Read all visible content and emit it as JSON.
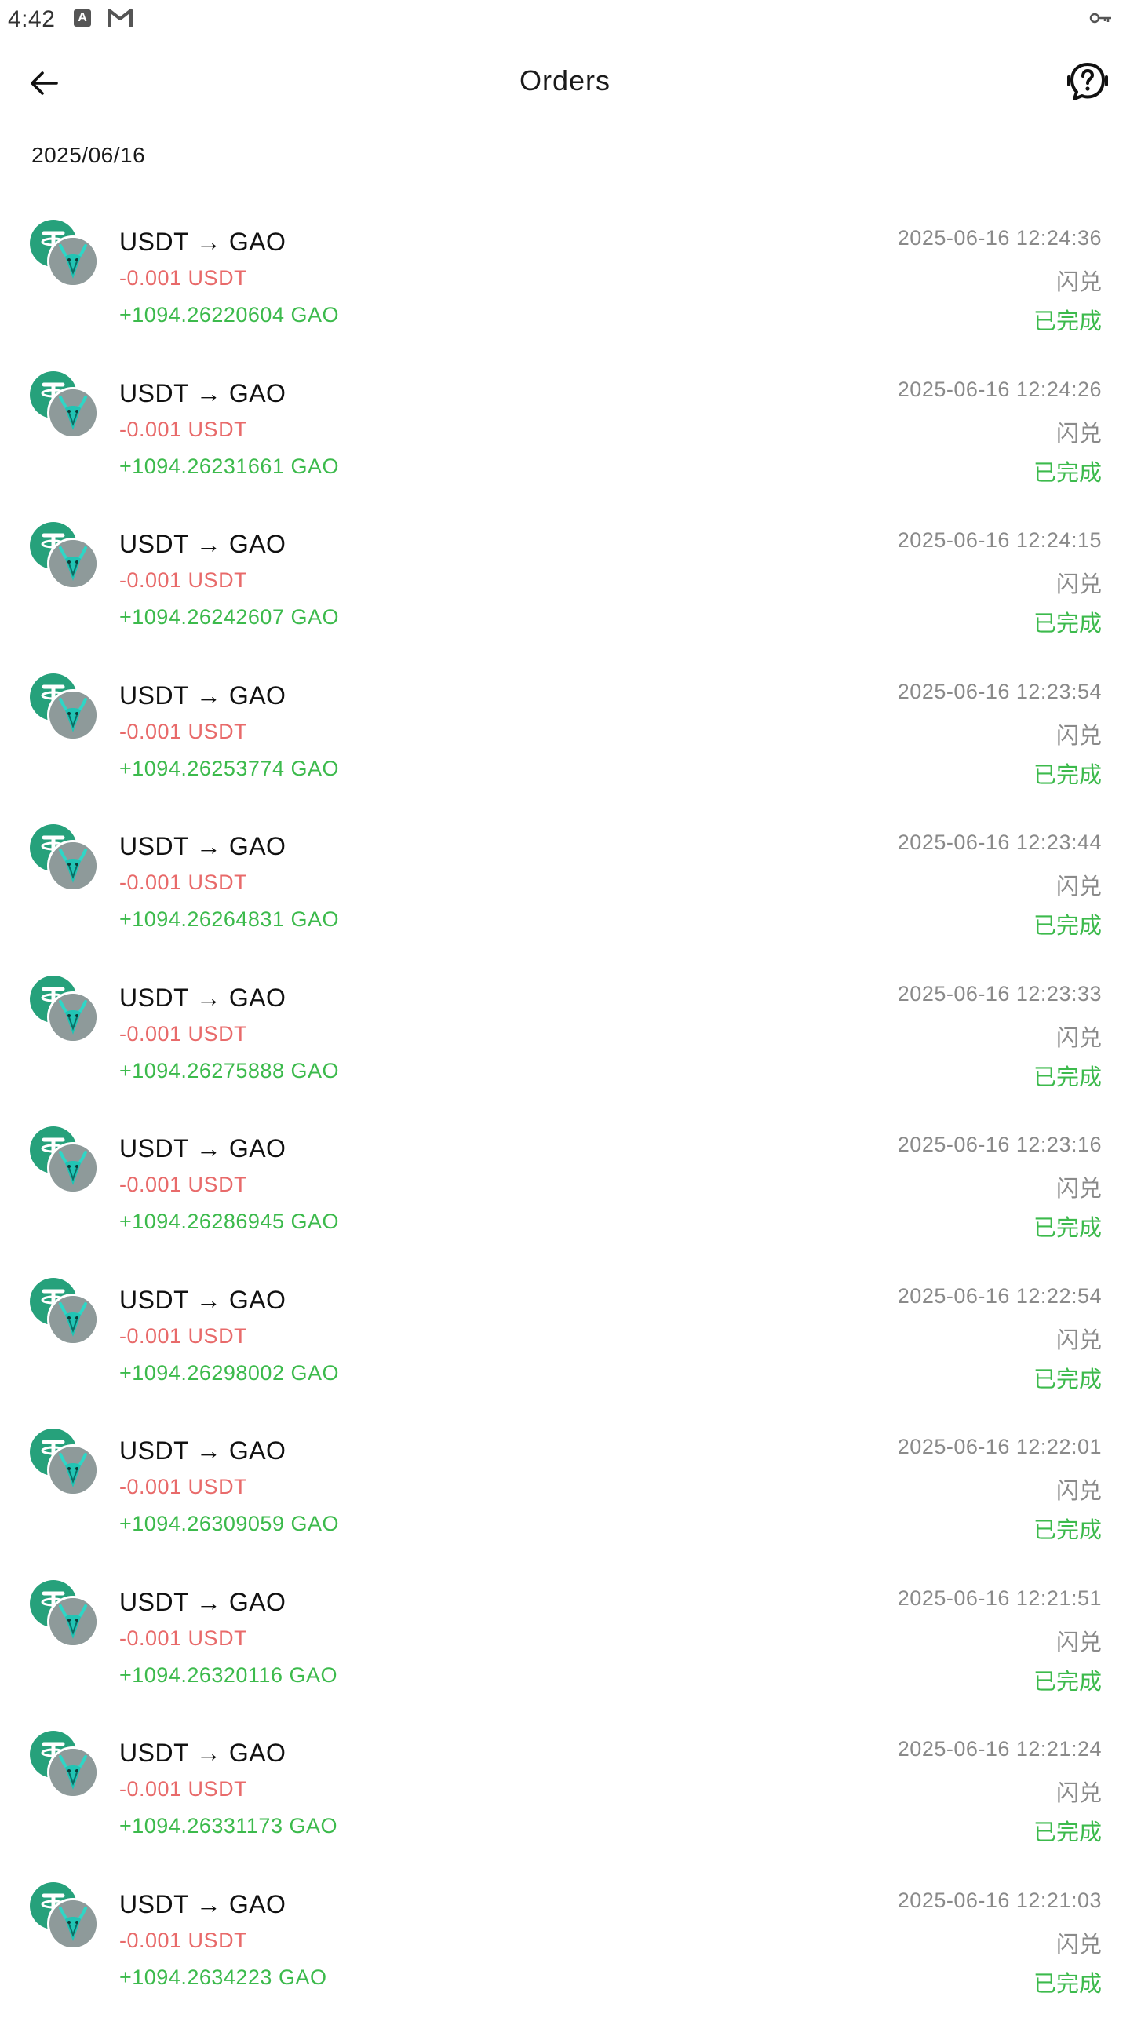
{
  "status_bar": {
    "time": "4:42",
    "icons": [
      "app-a-icon",
      "gmail-icon",
      "vpn-key-icon"
    ]
  },
  "header": {
    "title": "Orders",
    "back_icon": "arrow-left-icon",
    "support_icon": "help-chat-icon"
  },
  "date_heading": "2025/06/16",
  "colors": {
    "debit": "#e86a6a",
    "credit": "#3cba4c",
    "muted": "#8a8a8a",
    "usdt_brand": "#26a17b"
  },
  "orders": [
    {
      "title": "USDT → GAO",
      "debit": "-0.001 USDT",
      "credit": "+1094.26220604 GAO",
      "time": "2025-06-16 12:24:36",
      "type": "闪兑",
      "status": "已完成"
    },
    {
      "title": "USDT → GAO",
      "debit": "-0.001 USDT",
      "credit": "+1094.26231661 GAO",
      "time": "2025-06-16 12:24:26",
      "type": "闪兑",
      "status": "已完成"
    },
    {
      "title": "USDT → GAO",
      "debit": "-0.001 USDT",
      "credit": "+1094.26242607 GAO",
      "time": "2025-06-16 12:24:15",
      "type": "闪兑",
      "status": "已完成"
    },
    {
      "title": "USDT → GAO",
      "debit": "-0.001 USDT",
      "credit": "+1094.26253774 GAO",
      "time": "2025-06-16 12:23:54",
      "type": "闪兑",
      "status": "已完成"
    },
    {
      "title": "USDT → GAO",
      "debit": "-0.001 USDT",
      "credit": "+1094.26264831 GAO",
      "time": "2025-06-16 12:23:44",
      "type": "闪兑",
      "status": "已完成"
    },
    {
      "title": "USDT → GAO",
      "debit": "-0.001 USDT",
      "credit": "+1094.26275888 GAO",
      "time": "2025-06-16 12:23:33",
      "type": "闪兑",
      "status": "已完成"
    },
    {
      "title": "USDT → GAO",
      "debit": "-0.001 USDT",
      "credit": "+1094.26286945 GAO",
      "time": "2025-06-16 12:23:16",
      "type": "闪兑",
      "status": "已完成"
    },
    {
      "title": "USDT → GAO",
      "debit": "-0.001 USDT",
      "credit": "+1094.26298002 GAO",
      "time": "2025-06-16 12:22:54",
      "type": "闪兑",
      "status": "已完成"
    },
    {
      "title": "USDT → GAO",
      "debit": "-0.001 USDT",
      "credit": "+1094.26309059 GAO",
      "time": "2025-06-16 12:22:01",
      "type": "闪兑",
      "status": "已完成"
    },
    {
      "title": "USDT → GAO",
      "debit": "-0.001 USDT",
      "credit": "+1094.26320116 GAO",
      "time": "2025-06-16 12:21:51",
      "type": "闪兑",
      "status": "已完成"
    },
    {
      "title": "USDT → GAO",
      "debit": "-0.001 USDT",
      "credit": "+1094.26331173 GAO",
      "time": "2025-06-16 12:21:24",
      "type": "闪兑",
      "status": "已完成"
    },
    {
      "title": "USDT → GAO",
      "debit": "-0.001 USDT",
      "credit": "+1094.2634223 GAO",
      "time": "2025-06-16 12:21:03",
      "type": "闪兑",
      "status": "已完成"
    }
  ]
}
